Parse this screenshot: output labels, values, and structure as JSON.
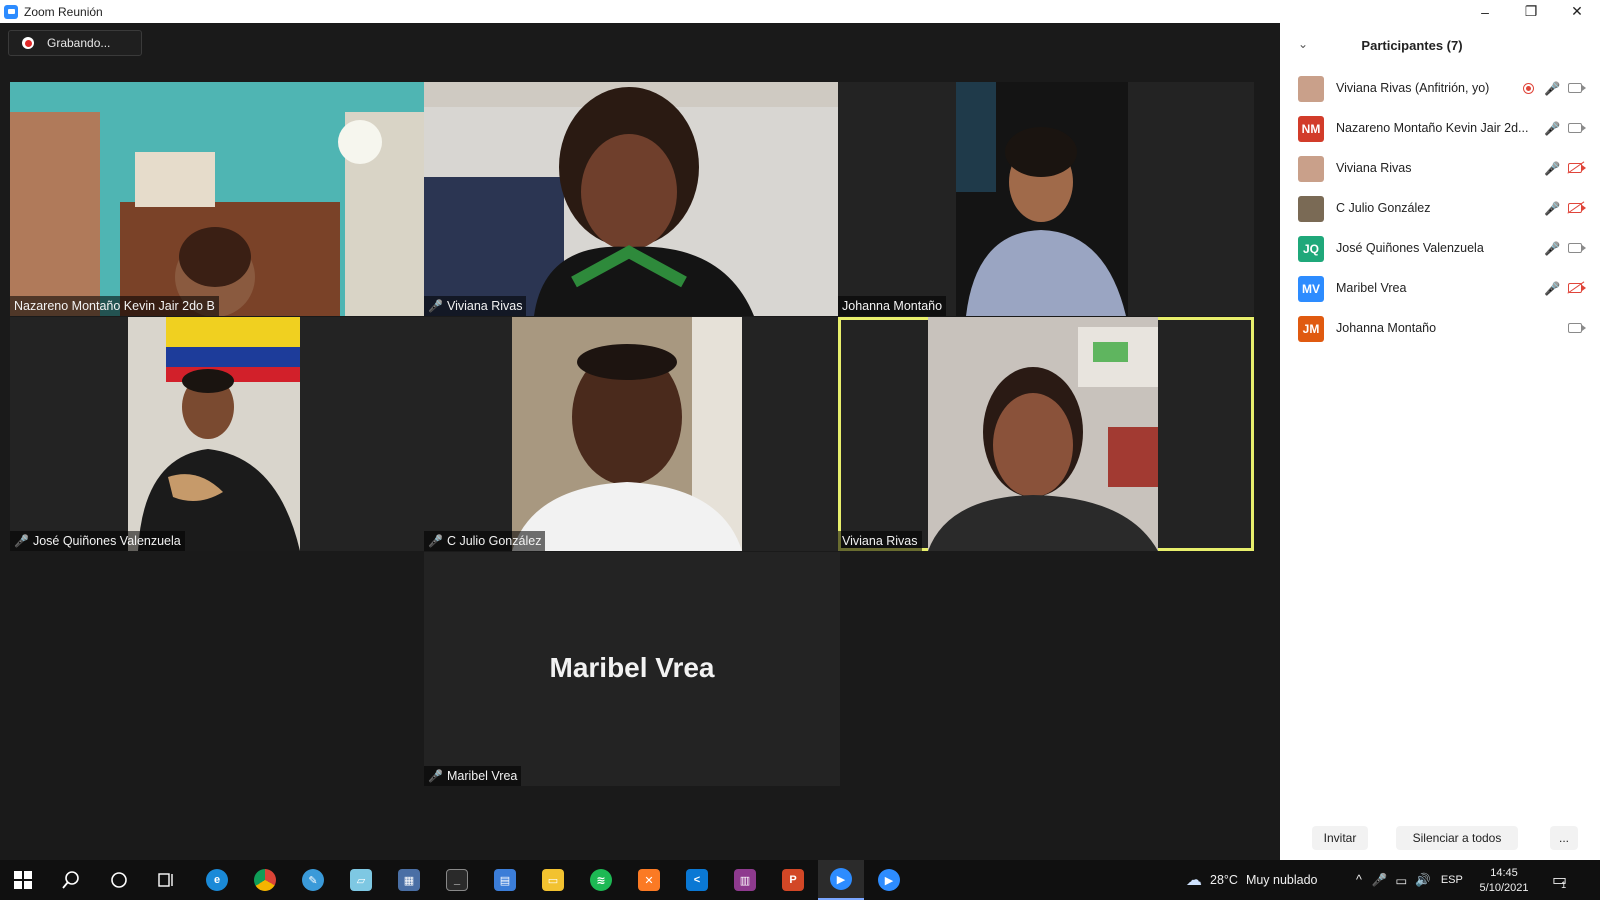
{
  "window": {
    "title": "Zoom Reunión",
    "minimize": "–",
    "restore": "❐",
    "close": "✕"
  },
  "recording": {
    "label": "Grabando..."
  },
  "tiles": [
    {
      "name": "Nazareno Montaño Kevin Jair 2do B",
      "muted": false,
      "bg": "#4fb5b3"
    },
    {
      "name": "Viviana Rivas",
      "muted": true,
      "bg": "#3a3a3a"
    },
    {
      "name": "Johanna Montaño",
      "muted": false,
      "bg": "#151515"
    },
    {
      "name": "José Quiñones Valenzuela",
      "muted": true,
      "bg": "#d9d5cc"
    },
    {
      "name": "C Julio González",
      "muted": true,
      "bg": "#a89880"
    },
    {
      "name": "Viviana Rivas",
      "muted": false,
      "bg": "#c8c2bc",
      "active": true
    },
    {
      "name": "Maribel Vrea",
      "muted": true,
      "big_name": "Maribel Vrea"
    }
  ],
  "participants": {
    "title": "Participantes (7)",
    "items": [
      {
        "name": "Viviana Rivas (Anfitrión, yo)",
        "avatar": "",
        "avatar_color": "#c9a08a",
        "recording": true,
        "mic": "muted",
        "video": "on"
      },
      {
        "name": "Nazareno Montaño Kevin Jair 2d...",
        "avatar": "NM",
        "avatar_color": "#d23c2a",
        "mic": "on",
        "video": "on"
      },
      {
        "name": "Viviana Rivas",
        "avatar": "",
        "avatar_color": "#c9a08a",
        "mic": "on",
        "video": "off"
      },
      {
        "name": "C Julio González",
        "avatar": "",
        "avatar_color": "#7a6a55",
        "mic": "muted",
        "video": "off"
      },
      {
        "name": "José Quiñones Valenzuela",
        "avatar": "JQ",
        "avatar_color": "#1fa87a",
        "mic": "muted",
        "video": "on"
      },
      {
        "name": "Maribel Vrea",
        "avatar": "MV",
        "avatar_color": "#2d8cff",
        "mic": "muted",
        "video": "off"
      },
      {
        "name": "Johanna Montaño",
        "avatar": "JM",
        "avatar_color": "#e05a10",
        "mic": "none",
        "video": "on"
      }
    ],
    "invite": "Invitar",
    "mute_all": "Silenciar a todos",
    "more": "..."
  },
  "taskbar": {
    "weather_temp": "28°C",
    "weather_text": "Muy nublado",
    "language": "ESP",
    "time": "14:45",
    "date": "5/10/2021",
    "notif_count": "1"
  }
}
